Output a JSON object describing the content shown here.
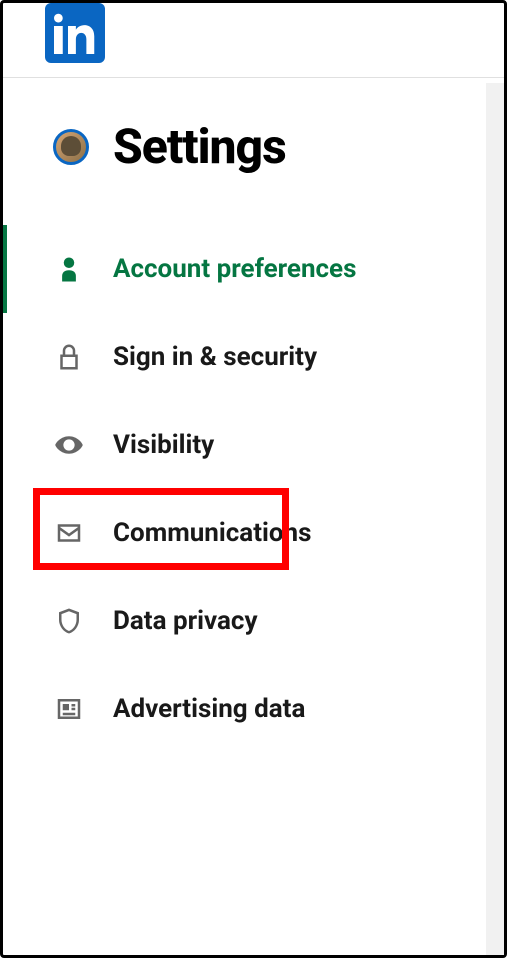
{
  "header": {
    "logo_name": "linkedin-logo"
  },
  "page": {
    "title": "Settings"
  },
  "nav": {
    "items": [
      {
        "label": "Account preferences",
        "icon": "person-icon",
        "active": true
      },
      {
        "label": "Sign in & security",
        "icon": "lock-icon",
        "active": false
      },
      {
        "label": "Visibility",
        "icon": "eye-icon",
        "active": false,
        "highlighted": true
      },
      {
        "label": "Communications",
        "icon": "mail-icon",
        "active": false
      },
      {
        "label": "Data privacy",
        "icon": "shield-icon",
        "active": false
      },
      {
        "label": "Advertising data",
        "icon": "news-icon",
        "active": false
      }
    ]
  },
  "colors": {
    "brand": "#0a66c2",
    "active": "#057642",
    "highlight": "#ff0000",
    "icon": "#666666",
    "text": "#191919"
  }
}
